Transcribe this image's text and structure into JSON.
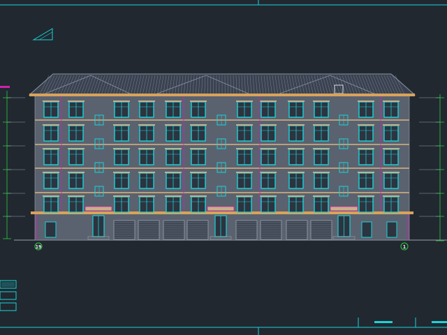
{
  "drawing": {
    "title": "",
    "axis_left": "19",
    "axis_right": "1",
    "floors": 6,
    "bays": 15
  },
  "colors": {
    "background": "#212830",
    "frame": "#19d4d8",
    "roof": "#8a96a8",
    "cornice": "#d9a35a",
    "wall": "#5a6270",
    "window": "#19d4d8",
    "door": "#d020b0",
    "dimension": "#2ecc40",
    "garage": "#9aa2ad"
  }
}
